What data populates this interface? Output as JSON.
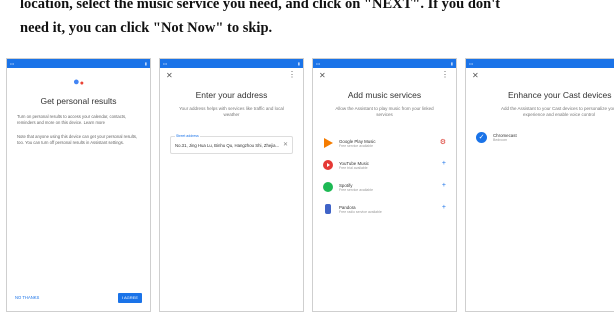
{
  "instructions": {
    "line1": "location, select the music service you need, and click on \"NEXT\". If you don't",
    "line2": "need it, you can click \"Not Now\" to skip."
  },
  "screens": [
    {
      "title": "Get personal results",
      "body1": "Turn on personal results to access your calendar, contacts, reminders and more on this device. Learn more",
      "body2": "Note that anyone using this device can get your personal results, too. You can turn off personal results in Assistant settings.",
      "left_button": "NO THANKS",
      "right_button": "I AGREE"
    },
    {
      "title": "Enter your address",
      "subtitle": "Your address helps with services like traffic and local weather",
      "address_label": "Street address",
      "address_value": "No.31, Jing Hua Lu, Binhu Qu, Hangzhou Shi, Zhejia..."
    },
    {
      "title": "Add music services",
      "subtitle": "Allow the Assistant to play music from your linked services",
      "services": [
        {
          "name": "Google Play Music",
          "desc": "Free service available",
          "icon_color": "#f57c00"
        },
        {
          "name": "YouTube Music",
          "desc": "Free trial available",
          "icon_color": "#e53935"
        },
        {
          "name": "Spotify",
          "desc": "Free service available",
          "icon_color": "#1db954"
        },
        {
          "name": "Pandora",
          "desc": "Free radio service available",
          "icon_color": "#3f63c7"
        }
      ]
    },
    {
      "title": "Enhance your Cast devices",
      "subtitle": "Add the Assistant to your Cast devices to personalize your experience and enable voice control",
      "device_name": "Chromecast",
      "device_sub": "Bedroom"
    }
  ]
}
